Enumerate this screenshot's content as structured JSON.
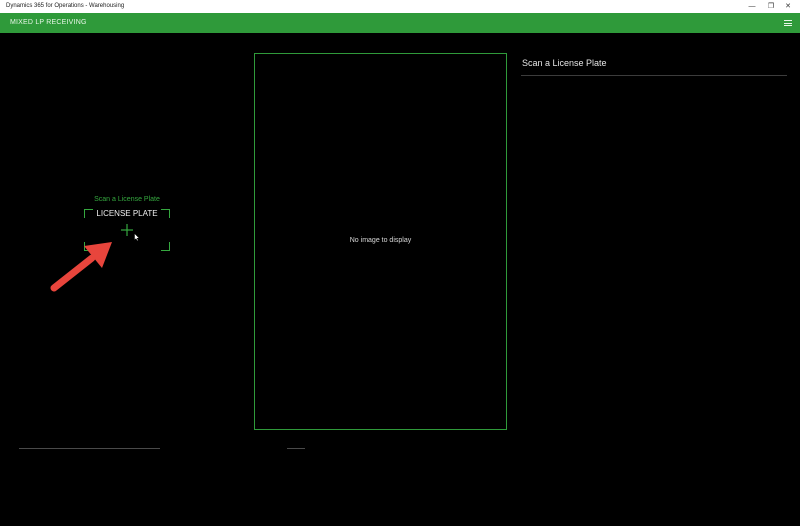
{
  "window": {
    "title": "Dynamics 365 for Operations - Warehousing",
    "controls": {
      "minimize": "—",
      "maximize": "❐",
      "close": "✕"
    }
  },
  "appbar": {
    "title": "MIXED LP RECEIVING",
    "menu_icon": "hamburger-icon"
  },
  "scan": {
    "hint": "Scan a License Plate",
    "field_label": "LICENSE PLATE",
    "add_icon": "plus-icon"
  },
  "image_panel": {
    "empty_text": "No image to display"
  },
  "info_panel": {
    "heading": "Scan a License Plate"
  },
  "colors": {
    "accent": "#2f9a3a",
    "annotation_arrow": "#e8453c",
    "background": "#000000"
  }
}
